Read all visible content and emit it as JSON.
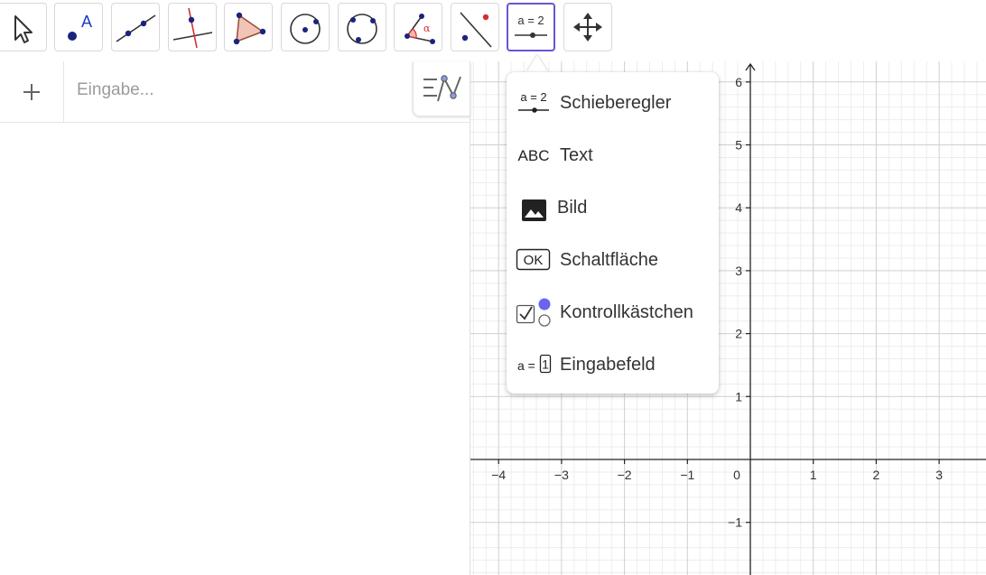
{
  "toolbar": {
    "tools": [
      {
        "name": "move-tool",
        "icon": "cursor-arrow-icon"
      },
      {
        "name": "point-tool",
        "icon": "point-icon",
        "icon_text": "A"
      },
      {
        "name": "line-tool",
        "icon": "line-icon"
      },
      {
        "name": "perpendicular-tool",
        "icon": "perpendicular-line-icon"
      },
      {
        "name": "polygon-tool",
        "icon": "polygon-icon"
      },
      {
        "name": "circle-tool",
        "icon": "circle-center-point-icon"
      },
      {
        "name": "conic-tool",
        "icon": "circle-three-points-icon"
      },
      {
        "name": "angle-tool",
        "icon": "angle-icon",
        "icon_text": "α"
      },
      {
        "name": "reflect-tool",
        "icon": "reflect-icon"
      },
      {
        "name": "slider-tool",
        "icon": "slider-icon",
        "icon_text": "a = 2",
        "active": true
      },
      {
        "name": "move-graphics-tool",
        "icon": "move-graphics-view-icon"
      }
    ]
  },
  "algebra": {
    "add_label": "+",
    "input_placeholder": "Eingabe..."
  },
  "menu": {
    "items": [
      {
        "label": "Schieberegler",
        "icon": "slider-icon",
        "icon_text": "a = 2"
      },
      {
        "label": "Text",
        "icon": "text-icon",
        "icon_text": "ABC"
      },
      {
        "label": "Bild",
        "icon": "image-icon"
      },
      {
        "label": "Schaltfläche",
        "icon": "button-icon",
        "icon_text": "OK"
      },
      {
        "label": "Kontrollkästchen",
        "icon": "checkbox-icon"
      },
      {
        "label": "Eingabefeld",
        "icon": "input-box-icon",
        "icon_text": "a = 1"
      }
    ]
  },
  "graphics": {
    "x_ticks": [
      "−4",
      "−3",
      "−2",
      "−1",
      "0",
      "1",
      "2",
      "3"
    ],
    "y_ticks": [
      "6",
      "5",
      "4",
      "3",
      "2",
      "1",
      "−1"
    ],
    "accent_color": "#6557d2",
    "point_color": "#1a237e"
  }
}
